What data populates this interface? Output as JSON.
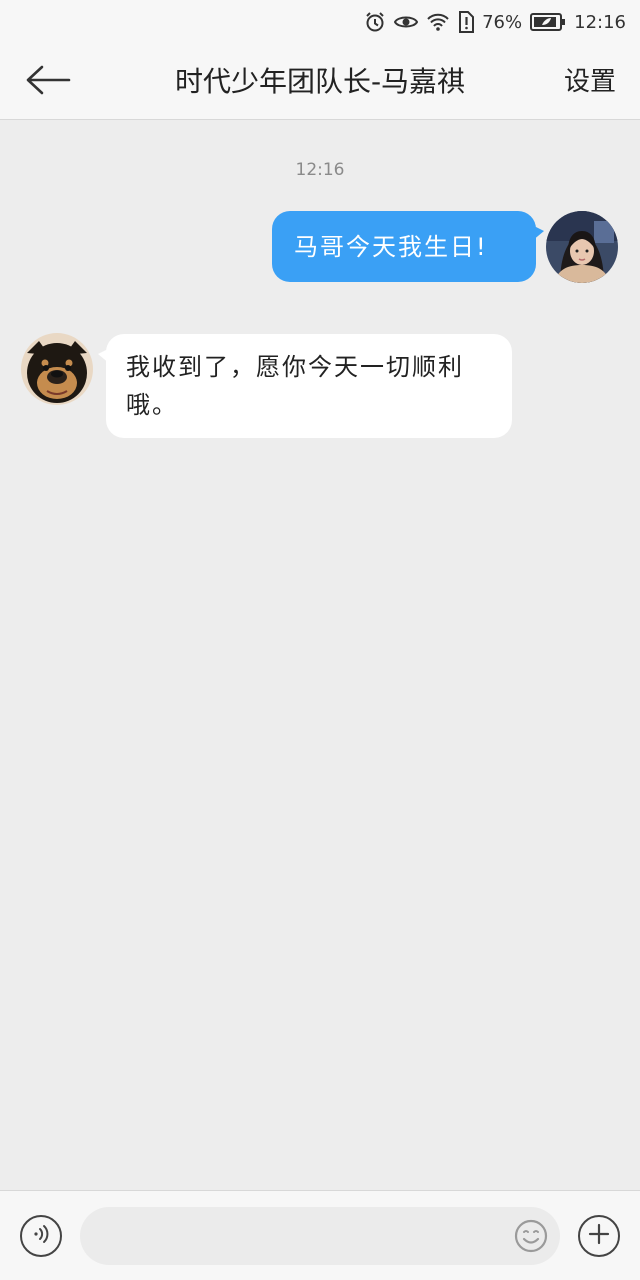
{
  "status_bar": {
    "battery_percent": "76%",
    "time": "12:16",
    "icons": [
      "alarm-icon",
      "eye-icon",
      "wifi-icon",
      "sim-alert-icon",
      "battery-icon"
    ]
  },
  "header": {
    "back_icon": "arrow-left-icon",
    "title": "时代少年团队长-马嘉祺",
    "settings_label": "设置"
  },
  "chat": {
    "timestamp": "12:16",
    "messages": [
      {
        "from": "me",
        "text": "马哥今天我生日!",
        "bubble_color": "#3aa0f5",
        "avatar": "girl-avatar"
      },
      {
        "from": "contact",
        "text": "我收到了，愿你今天一切顺利哦。",
        "bubble_color": "#ffffff",
        "avatar": "dog-avatar"
      }
    ]
  },
  "input_bar": {
    "voice_icon": "voice-icon",
    "input_value": "",
    "input_placeholder": "",
    "emoji_icon": "emoji-icon",
    "plus_icon": "plus-icon"
  },
  "colors": {
    "background": "#ededed",
    "header": "#f7f7f7",
    "sent_bubble": "#3aa0f5",
    "received_bubble": "#ffffff"
  }
}
